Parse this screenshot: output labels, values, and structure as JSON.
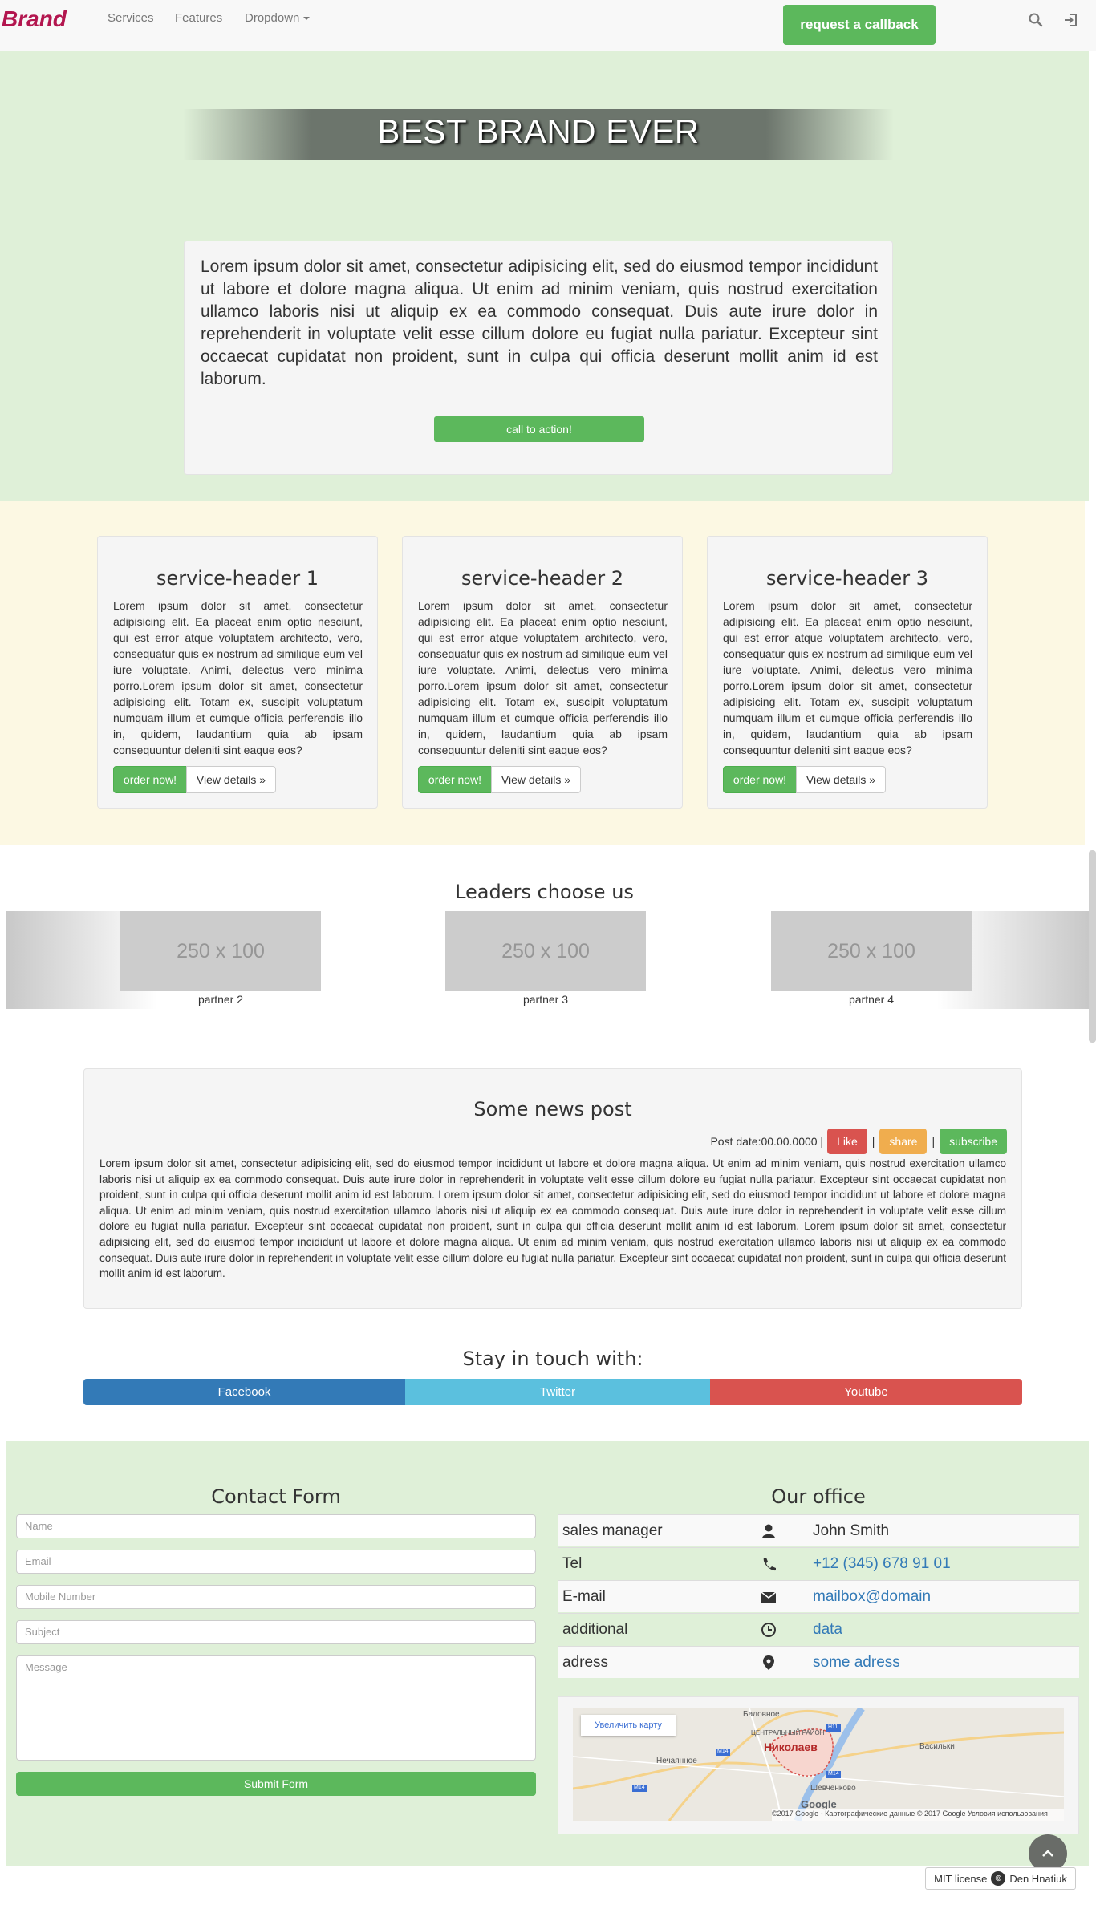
{
  "navbar": {
    "brand": "Brand",
    "links": [
      "Services",
      "Features",
      "Dropdown"
    ],
    "callback_label": "request a callback",
    "search_icon": "search-icon",
    "login_icon": "login-icon"
  },
  "hero": {
    "title": "BEST BRAND EVER",
    "text": "Lorem ipsum dolor sit amet, consectetur adipisicing elit, sed do eiusmod tempor incididunt ut labore et dolore magna aliqua. Ut enim ad minim veniam, quis nostrud exercitation ullamco laboris nisi ut aliquip ex ea commodo consequat. Duis aute irure dolor in reprehenderit in voluptate velit esse cillum dolore eu fugiat nulla pariatur. Excepteur sint occaecat cupidatat non proident, sunt in culpa qui officia deserunt mollit anim id est laborum.",
    "cta_label": "call to action!"
  },
  "services": [
    {
      "title": "service-header 1",
      "text": "Lorem ipsum dolor sit amet, consectetur adipisicing elit. Ea placeat enim optio nesciunt, qui est error atque voluptatem architecto, vero, consequatur quis ex nostrum ad similique eum vel iure voluptate. Animi, delectus vero minima porro.Lorem ipsum dolor sit amet, consectetur adipisicing elit. Totam ex, suscipit voluptatum numquam illum et cumque officia perferendis illo in, quidem, laudantium quia ab ipsam consequuntur deleniti sint eaque eos?",
      "order_label": "order now!",
      "details_label": "View details »"
    },
    {
      "title": "service-header 2",
      "text": "Lorem ipsum dolor sit amet, consectetur adipisicing elit. Ea placeat enim optio nesciunt, qui est error atque voluptatem architecto, vero, consequatur quis ex nostrum ad similique eum vel iure voluptate. Animi, delectus vero minima porro.Lorem ipsum dolor sit amet, consectetur adipisicing elit. Totam ex, suscipit voluptatum numquam illum et cumque officia perferendis illo in, quidem, laudantium quia ab ipsam consequuntur deleniti sint eaque eos?",
      "order_label": "order now!",
      "details_label": "View details »"
    },
    {
      "title": "service-header 3",
      "text": "Lorem ipsum dolor sit amet, consectetur adipisicing elit. Ea placeat enim optio nesciunt, qui est error atque voluptatem architecto, vero, consequatur quis ex nostrum ad similique eum vel iure voluptate. Animi, delectus vero minima porro.Lorem ipsum dolor sit amet, consectetur adipisicing elit. Totam ex, suscipit voluptatum numquam illum et cumque officia perferendis illo in, quidem, laudantium quia ab ipsam consequuntur deleniti sint eaque eos?",
      "order_label": "order now!",
      "details_label": "View details »"
    }
  ],
  "partners": {
    "title": "Leaders choose us",
    "items": [
      {
        "image_text": "250 x 100",
        "label": "partner 2"
      },
      {
        "image_text": "250 x 100",
        "label": "partner 3"
      },
      {
        "image_text": "250 x 100",
        "label": "partner 4"
      }
    ]
  },
  "news": {
    "title": "Some news post",
    "post_date": "Post date:00.00.0000 |",
    "like_label": "Like",
    "share_label": "share",
    "subscribe_label": "subscribe",
    "separator": "|",
    "body": "Lorem ipsum dolor sit amet, consectetur adipisicing elit, sed do eiusmod tempor incididunt ut labore et dolore magna aliqua. Ut enim ad minim veniam, quis nostrud exercitation ullamco laboris nisi ut aliquip ex ea commodo consequat. Duis aute irure dolor in reprehenderit in voluptate velit esse cillum dolore eu fugiat nulla pariatur. Excepteur sint occaecat cupidatat non proident, sunt in culpa qui officia deserunt mollit anim id est laborum. Lorem ipsum dolor sit amet, consectetur adipisicing elit, sed do eiusmod tempor incididunt ut labore et dolore magna aliqua. Ut enim ad minim veniam, quis nostrud exercitation ullamco laboris nisi ut aliquip ex ea commodo consequat. Duis aute irure dolor in reprehenderit in voluptate velit esse cillum dolore eu fugiat nulla pariatur. Excepteur sint occaecat cupidatat non proident, sunt in culpa qui officia deserunt mollit anim id est laborum. Lorem ipsum dolor sit amet, consectetur adipisicing elit, sed do eiusmod tempor incididunt ut labore et dolore magna aliqua. Ut enim ad minim veniam, quis nostrud exercitation ullamco laboris nisi ut aliquip ex ea commodo consequat. Duis aute irure dolor in reprehenderit in voluptate velit esse cillum dolore eu fugiat nulla pariatur. Excepteur sint occaecat cupidatat non proident, sunt in culpa qui officia deserunt mollit anim id est laborum."
  },
  "social": {
    "title": "Stay in touch with:",
    "facebook": "Facebook",
    "twitter": "Twitter",
    "youtube": "Youtube"
  },
  "contact_form": {
    "title": "Contact Form",
    "name_placeholder": "Name",
    "email_placeholder": "Email",
    "mobile_placeholder": "Mobile Number",
    "subject_placeholder": "Subject",
    "message_placeholder": "Message",
    "submit_label": "Submit Form"
  },
  "office": {
    "title": "Our office",
    "rows": [
      {
        "label": "sales manager",
        "icon": "user-icon",
        "value": "John Smith"
      },
      {
        "label": "Tel",
        "icon": "phone-icon",
        "value": "+12 (345) 678 91 01"
      },
      {
        "label": "E-mail",
        "icon": "envelope-icon",
        "value": "mailbox@domain"
      },
      {
        "label": "additional",
        "icon": "clock-icon",
        "value": "data"
      },
      {
        "label": "adress",
        "icon": "map-marker-icon",
        "value": "some adress"
      }
    ]
  },
  "map": {
    "enlarge_label": "Увеличить карту",
    "city": "Николаев",
    "places": [
      "Баловное",
      "ЦЕНТРАЛЬНЫЙ РАЙОН",
      "Нечаянное",
      "Васильки",
      "Шевченково"
    ],
    "roads": [
      "M14",
      "H11",
      "M14",
      "M14"
    ],
    "google": "Google",
    "attribution": "©2017 Google - Картографические данные © 2017 Google    Условия использования"
  },
  "footer": {
    "license_text": "MIT license",
    "cc_symbol": "©",
    "author": "Den Hnatiuk"
  },
  "colors": {
    "brand": "#b3164f",
    "success": "#5cb85c",
    "danger": "#d9534f",
    "warning": "#f0ad4e",
    "primary": "#337ab7",
    "info": "#5bc0de"
  }
}
